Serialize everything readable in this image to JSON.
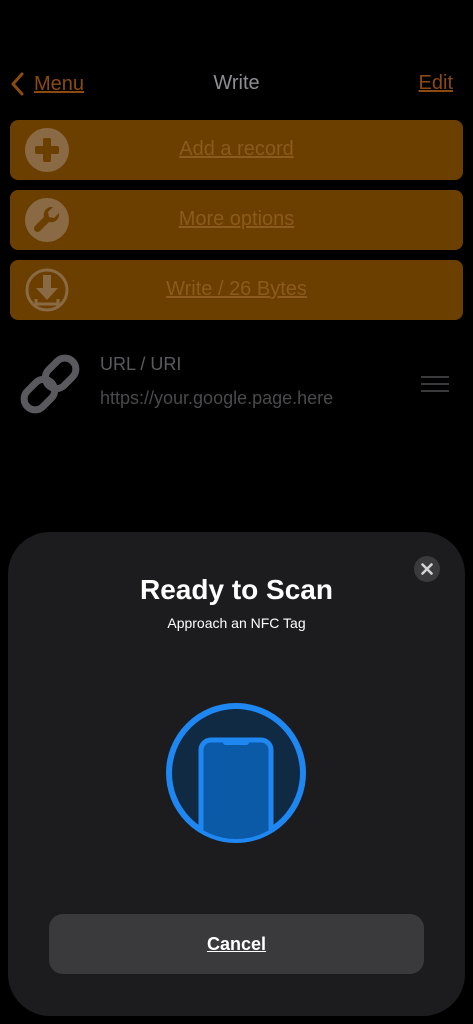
{
  "nav": {
    "back_label": "Menu",
    "title": "Write",
    "edit_label": "Edit"
  },
  "actions": [
    {
      "label": "Add a record",
      "icon": "plus-circle-icon"
    },
    {
      "label": "More options",
      "icon": "wrench-circle-icon"
    },
    {
      "label": "Write / 26 Bytes",
      "icon": "download-circle-icon"
    }
  ],
  "record": {
    "type": "URL / URI",
    "value": "https://your.google.page.here",
    "icon": "link-icon"
  },
  "sheet": {
    "title": "Ready to Scan",
    "subtitle": "Approach an NFC Tag",
    "cancel_label": "Cancel",
    "graphic": "phone-scan-icon"
  },
  "colors": {
    "accent": "#8a4a10",
    "button_bg": "#6b3f00",
    "scan_blue": "#1f87f2",
    "sheet_bg": "#1c1c1e"
  }
}
